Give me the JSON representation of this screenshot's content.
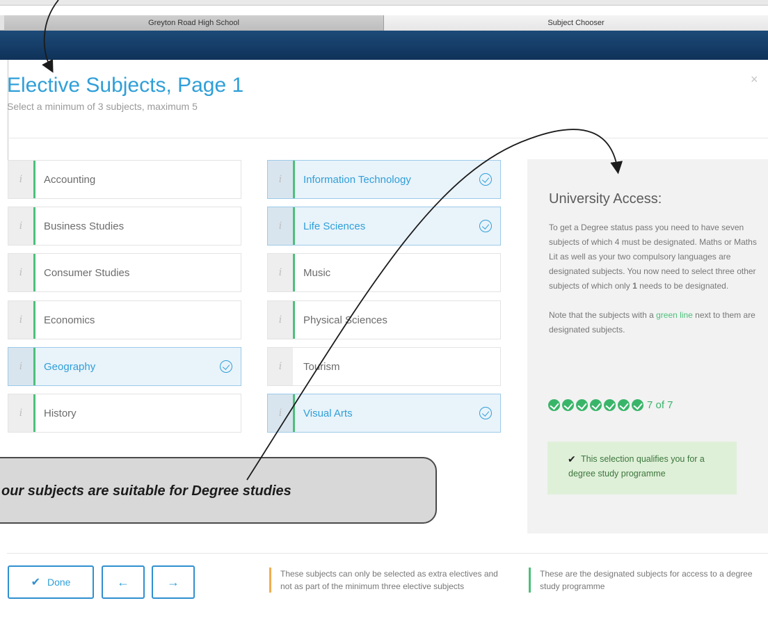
{
  "browser": {
    "tabs": [
      {
        "label": "Greyton Road High School"
      },
      {
        "label": "Subject Chooser"
      }
    ]
  },
  "modal": {
    "title": "Elective Subjects, Page 1",
    "subtitle": "Select a minimum of 3 subjects, maximum 5",
    "close_label": "×"
  },
  "subjects": [
    {
      "name": "Accounting",
      "selected": false,
      "designated": true
    },
    {
      "name": "Business Studies",
      "selected": false,
      "designated": true
    },
    {
      "name": "Consumer Studies",
      "selected": false,
      "designated": true
    },
    {
      "name": "Economics",
      "selected": false,
      "designated": true
    },
    {
      "name": "Geography",
      "selected": true,
      "designated": true
    },
    {
      "name": "History",
      "selected": false,
      "designated": true
    },
    {
      "name": "Information Technology",
      "selected": true,
      "designated": true
    },
    {
      "name": "Life Sciences",
      "selected": true,
      "designated": true
    },
    {
      "name": "Music",
      "selected": false,
      "designated": true
    },
    {
      "name": "Physical Sciences",
      "selected": false,
      "designated": true
    },
    {
      "name": "Tourism",
      "selected": false,
      "designated": false
    },
    {
      "name": "Visual Arts",
      "selected": true,
      "designated": true
    }
  ],
  "info_icon": "i",
  "panel": {
    "title": "University Access:",
    "text_1": "To get a Degree status pass you need to have seven subjects of which 4 must be designated. Maths or Maths Lit as well as your two compulsory languages are designated subjects. You now need to select three other subjects of which only ",
    "text_1_bold": "1",
    "text_1_end": " needs to be designated.",
    "text_2_start": "Note that the subjects with a ",
    "text_2_green": "green line",
    "text_2_end": " next to them are designated subjects.",
    "count": "7 of 7",
    "qualify_text": "This selection qualifies you for a degree study programme"
  },
  "callout": {
    "text": "our subjects are suitable for Degree studies"
  },
  "footer": {
    "done_label": "Done",
    "prev_icon": "←",
    "next_icon": "→",
    "legend_orange": "These subjects can only be selected as extra electives and not as part of the minimum three elective subjects",
    "legend_green": "These are the designated subjects for access to a degree study programme"
  },
  "colors": {
    "accent": "#2f9fd8",
    "designated": "#4cc07a",
    "extra": "#f0ad4e",
    "header": "#163f6a"
  },
  "icons": {
    "check": "check-circle-icon",
    "tick": "checkmark-icon",
    "prev": "arrow-left-icon",
    "next": "arrow-right-icon",
    "close": "close-icon"
  }
}
